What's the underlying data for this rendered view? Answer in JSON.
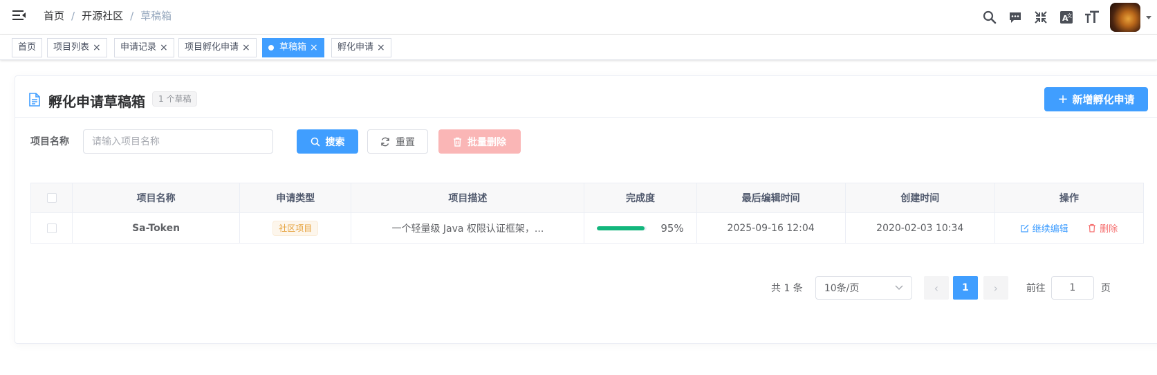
{
  "breadcrumb": [
    "首页",
    "开源社区",
    "草稿箱"
  ],
  "breadcrumb_separator": "/",
  "tags": [
    {
      "label": "首页",
      "closable": false,
      "active": false
    },
    {
      "label": "项目列表",
      "closable": true,
      "active": false
    },
    {
      "label": "申请记录",
      "closable": true,
      "active": false
    },
    {
      "label": "项目孵化申请",
      "closable": true,
      "active": false
    },
    {
      "label": "草稿箱",
      "closable": true,
      "active": true
    },
    {
      "label": "孵化申请",
      "closable": true,
      "active": false
    }
  ],
  "header_icons": [
    "search-icon",
    "message-icon",
    "exit-fullscreen-icon",
    "translate-icon",
    "font-size-icon"
  ],
  "card": {
    "title": "孵化申请草稿箱",
    "draft_count": "1 个草稿",
    "add_button": "新增孵化申请"
  },
  "search": {
    "label": "项目名称",
    "placeholder": "请输入项目名称",
    "search_button": "搜索",
    "reset_button": "重置",
    "batch_delete_button": "批量删除"
  },
  "table": {
    "columns": [
      "项目名称",
      "申请类型",
      "项目描述",
      "完成度",
      "最后编辑时间",
      "创建时间",
      "操作"
    ],
    "rows": [
      {
        "name": "Sa-Token",
        "type": "社区项目",
        "description": "一个轻量级 Java 权限认证框架，...",
        "progress": 95,
        "progress_label": "95%",
        "last_edited": "2025-09-16 12:04",
        "created": "2020-02-03 10:34",
        "edit_label": "继续编辑",
        "delete_label": "删除"
      }
    ]
  },
  "pagination": {
    "total": "共 1 条",
    "page_size": "10条/页",
    "current_page": "1",
    "goto_label": "前往",
    "goto_value": "1",
    "page_suffix": "页"
  },
  "colors": {
    "primary": "#409eff",
    "danger": "#f56c6c",
    "warning": "#e6a23c",
    "progress": "#13b67c"
  }
}
